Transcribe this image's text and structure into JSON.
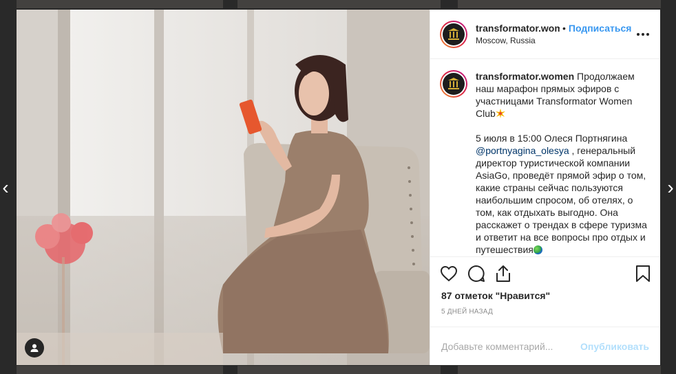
{
  "post": {
    "username": "transformator.women",
    "separator": "•",
    "follow_label": "Подписаться",
    "location": "Moscow, Russia"
  },
  "caption": {
    "username": "transformator.women",
    "text_1": " Продолжаем наш марафон прямых эфиров с участницами Transformator Women Club",
    "text_2": "5 июля в 15:00 Олеся Портнягина ",
    "mention": "@portnyagina_olesya",
    "text_3": " , генеральный директор туристической компании AsiaGo, проведёт прямой эфир о том, какие страны сейчас пользуются наибольшим спросом, об отелях, о том, как отдыхать выгодно. Она расскажет о трендах в сфере туризма и ответит на все вопросы про отдых и путешествия"
  },
  "engagement": {
    "likes": "87 отметок \"Нравится\"",
    "time_ago": "5 дней назад"
  },
  "comment": {
    "placeholder": "Добавьте комментарий...",
    "publish_label": "Опубликовать"
  },
  "icons": {
    "like": "heart-icon",
    "comment": "comment-bubble-icon",
    "share": "share-icon",
    "save": "bookmark-icon",
    "more": "more-dots-icon",
    "user_tag": "person-icon",
    "prev": "chevron-left-icon",
    "next": "chevron-right-icon"
  },
  "colors": {
    "link_blue": "#3897f0",
    "publish_disabled": "#b2dffc",
    "text": "#262626",
    "muted": "#8e8e8e"
  }
}
